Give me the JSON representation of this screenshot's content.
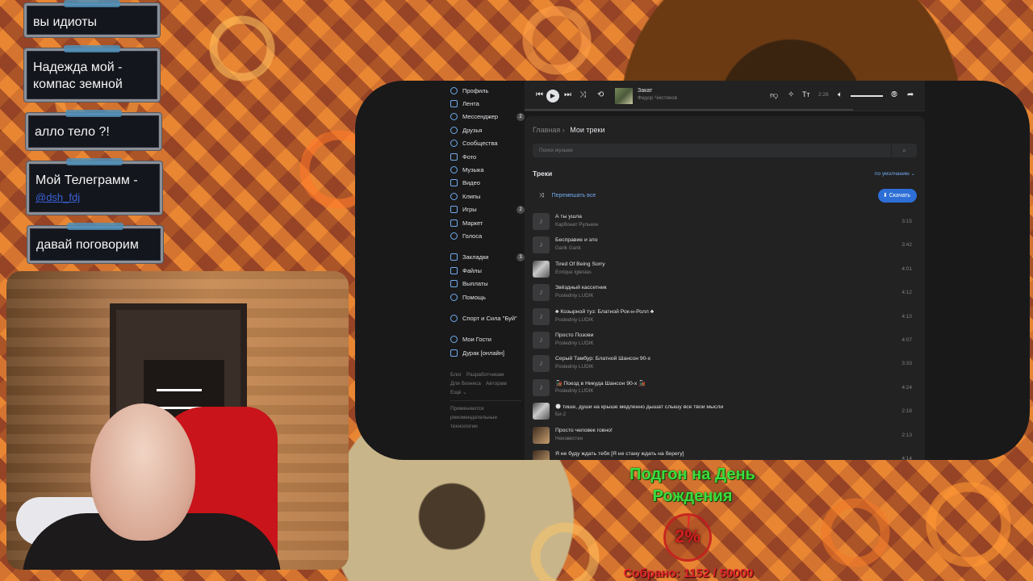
{
  "chat": [
    {
      "text": "вы идиоты"
    },
    {
      "text": "Надежда мой - компас земной"
    },
    {
      "text": "алло тело ?!"
    },
    {
      "text": "Мой Телеграмм -",
      "link": "@dsh_fdj"
    },
    {
      "text": "давай поговорим"
    }
  ],
  "sidebar": {
    "items": [
      {
        "label": "Профиль"
      },
      {
        "label": "Лента"
      },
      {
        "label": "Мессенджер",
        "badge": "2"
      },
      {
        "label": "Друзья"
      },
      {
        "label": "Сообщества"
      },
      {
        "label": "Фото"
      },
      {
        "label": "Музыка"
      },
      {
        "label": "Видео"
      },
      {
        "label": "Клипы"
      },
      {
        "label": "Игры",
        "badge": "2"
      },
      {
        "label": "Маркет"
      },
      {
        "label": "Голоса"
      }
    ],
    "items2": [
      {
        "label": "Закладки",
        "badge": "3"
      },
      {
        "label": "Файлы"
      },
      {
        "label": "Выплаты"
      },
      {
        "label": "Помощь"
      }
    ],
    "group": "Спорт и Сила \"Буй\"",
    "items3": [
      {
        "label": "Мои Гости"
      },
      {
        "label": "Дурак [онлайн]"
      }
    ],
    "footer": [
      "Блог",
      "Разработчикам",
      "Для бизнеса",
      "Авторам",
      "Ещё ⌄"
    ],
    "note": "Применяются рекомендательные технологии"
  },
  "player": {
    "title": "Закат",
    "artist": "Федор Чистяков",
    "time": "2:28"
  },
  "page": {
    "breadcrumb_root": "Главная",
    "breadcrumb_current": "Мои треки",
    "search_placeholder": "Поиск музыки",
    "tracks_heading": "Треки",
    "sort_label": "по умолчанию ⌄",
    "shuffle_label": "Перемешать все",
    "download_label": "Скачать"
  },
  "tracks": [
    {
      "title": "А ты ушла",
      "artist": "Карбонат Рулькин",
      "duration": "3:15",
      "cover": "note"
    },
    {
      "title": "Бесправие и зло",
      "artist": "Garik Garik",
      "duration": "3:42",
      "cover": "note"
    },
    {
      "title": "Tired Of Being Sorry",
      "artist": "Enrique Iglesias",
      "duration": "4:01",
      "cover": "photo"
    },
    {
      "title": "Звёздный кассетник",
      "artist": "Posledniy LUDIK",
      "duration": "4:12",
      "cover": "note"
    },
    {
      "title": "♣ Козырной туз: Блатной Рок-н-Ролл ♣",
      "artist": "Posledniy LUDIK",
      "duration": "4:10",
      "cover": "note"
    },
    {
      "title": "Просто Позови",
      "artist": "Posledniy LUDIK",
      "duration": "4:07",
      "cover": "note"
    },
    {
      "title": "Серый Тамбур: Блатной Шансон 90-х",
      "artist": "Posledniy LUDIK",
      "duration": "3:33",
      "cover": "note"
    },
    {
      "title": "🚂 Поезд в Никуда Шансон 90-х 🚂",
      "artist": "Posledniy LUDIK",
      "duration": "4:24",
      "cover": "note"
    },
    {
      "title": "🌑 тише, души на крыше медленно дышат слышу все твои мысли",
      "artist": "Би-2",
      "duration": "2:18",
      "cover": "photo"
    },
    {
      "title": "Просто человек говно!",
      "artist": "Неизвестен",
      "duration": "2:13",
      "cover": "photo2"
    },
    {
      "title": "Я не буду ждать тебя [Я не стану ждать на берегу]",
      "artist": "",
      "duration": "4:14",
      "cover": "photo2"
    }
  ],
  "donation": {
    "title": "Подгон на День Рождения",
    "percent": "2%",
    "progress": 0.02,
    "collected": "Собрано: 1152 / 50000"
  },
  "colors": {
    "accent": "#71aaeb",
    "download": "#2d6fd6",
    "donation_green": "#3ddc3d",
    "donation_red": "#e0262a"
  }
}
